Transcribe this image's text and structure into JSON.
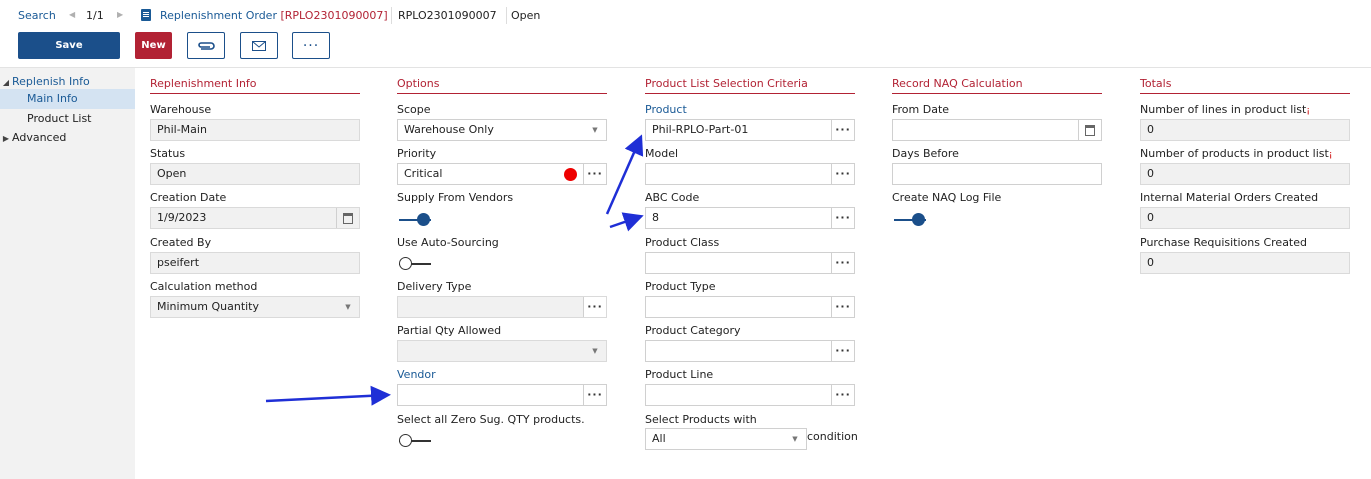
{
  "header": {
    "search_label": "Search",
    "pager": "1/1",
    "record_type": "Replenishment Order",
    "record_id_bracket": "[RPLO2301090007]",
    "record_id": "RPLO2301090007",
    "record_status": "Open"
  },
  "toolbar": {
    "save_label": "Save",
    "new_label": "New",
    "more_label": "···"
  },
  "sidebar": {
    "items": [
      {
        "label": "Replenish Info"
      },
      {
        "label": "Main Info"
      },
      {
        "label": "Product List"
      },
      {
        "label": "Advanced"
      }
    ]
  },
  "replenishment_info": {
    "title": "Replenishment Info",
    "warehouse_label": "Warehouse",
    "warehouse_value": "Phil-Main",
    "status_label": "Status",
    "status_value": "Open",
    "creation_date_label": "Creation Date",
    "creation_date_value": "1/9/2023",
    "created_by_label": "Created By",
    "created_by_value": "pseifert",
    "calc_method_label": "Calculation method",
    "calc_method_value": "Minimum Quantity"
  },
  "options": {
    "title": "Options",
    "scope_label": "Scope",
    "scope_value": "Warehouse Only",
    "priority_label": "Priority",
    "priority_value": "Critical",
    "supply_label": "Supply From Vendors",
    "supply_on": true,
    "auto_sourcing_label": "Use Auto-Sourcing",
    "auto_sourcing_on": false,
    "delivery_type_label": "Delivery Type",
    "delivery_type_value": "",
    "partial_qty_label": "Partial Qty Allowed",
    "partial_qty_value": "",
    "vendor_label": "Vendor",
    "vendor_value": "",
    "zero_sug_label": "Select all Zero Sug. QTY products.",
    "zero_sug_on": false
  },
  "criteria": {
    "title": "Product List Selection Criteria",
    "product_label": "Product",
    "product_value": "Phil-RPLO-Part-01",
    "model_label": "Model",
    "model_value": "",
    "abc_label": "ABC Code",
    "abc_value": "8",
    "class_label": "Product Class",
    "class_value": "",
    "type_label": "Product Type",
    "type_value": "",
    "category_label": "Product Category",
    "category_value": "",
    "line_label": "Product Line",
    "line_value": "",
    "select_with_label": "Select Products with",
    "select_with_value": "All",
    "condition_label": "condition"
  },
  "naq": {
    "title": "Record NAQ Calculation",
    "from_date_label": "From Date",
    "from_date_value": "",
    "days_before_label": "Days Before",
    "days_before_value": "",
    "log_file_label": "Create NAQ Log File",
    "log_file_on": true
  },
  "totals": {
    "title": "Totals",
    "lines_label": "Number of lines in product list",
    "lines_value": "0",
    "products_label": "Number of products in product list",
    "products_value": "0",
    "imo_label": "Internal Material Orders Created",
    "imo_value": "0",
    "pr_label": "Purchase Requisitions Created",
    "pr_value": "0"
  },
  "colors": {
    "brand_blue": "#1b4f8a",
    "link_blue": "#1a5a96",
    "accent_red": "#b22234",
    "priority_dot": "#ee0000",
    "annotation_arrow": "#1f2fd6"
  }
}
